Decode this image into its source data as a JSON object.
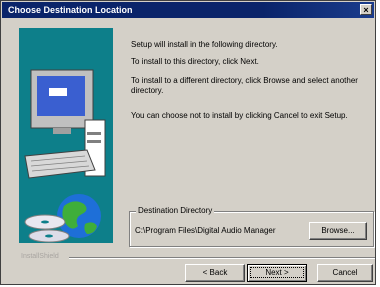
{
  "window": {
    "title": "Choose Destination Location",
    "close_label": "×"
  },
  "messages": [
    "Setup will install  in the following directory.",
    "To install to this directory, click Next.",
    "To install to a different directory, click Browse and select another directory.",
    "You can choose not to install  by clicking Cancel to exit Setup."
  ],
  "destination": {
    "group_label": "Destination Directory",
    "path": "C:\\Program Files\\Digital Audio Manager",
    "browse_label": "Browse..."
  },
  "footer": {
    "brand": "InstallShield",
    "back_label": "< Back",
    "next_label": "Next >",
    "cancel_label": "Cancel"
  },
  "colors": {
    "titlebar": "#0a246a",
    "artwork_bg": "#0d7f8a",
    "dialog_bg": "#d4d0c8"
  }
}
